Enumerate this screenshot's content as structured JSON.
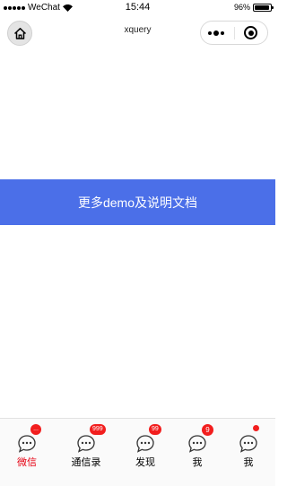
{
  "status_bar": {
    "carrier": "WeChat",
    "time": "15:44",
    "battery": "96%",
    "battery_level_percent": 96
  },
  "nav_bar": {
    "title": "xquery",
    "home_icon": "home-icon",
    "more_icon": "more-icon",
    "close_icon": "close-mini-icon"
  },
  "main": {
    "button_label": "更多demo及说明文档",
    "button_color": "#4b6fe8"
  },
  "tab_bar": {
    "active_color": "#e60012",
    "badge_color": "#f21e1e",
    "tabs": [
      {
        "label": "微信",
        "badge": "...",
        "active": true
      },
      {
        "label": "通信录",
        "badge": "999",
        "active": false
      },
      {
        "label": "发现",
        "badge": "99",
        "active": false
      },
      {
        "label": "我",
        "badge": "9",
        "active": false
      },
      {
        "label": "我",
        "badge": "",
        "dot": true,
        "active": false
      }
    ]
  }
}
